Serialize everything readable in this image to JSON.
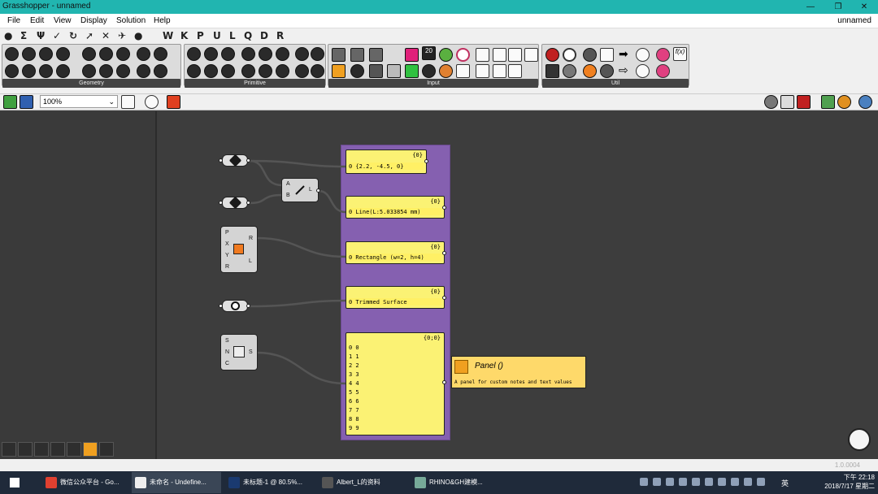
{
  "window": {
    "title": "Grasshopper - unnamed",
    "doc_name": "unnamed"
  },
  "menu": [
    "File",
    "Edit",
    "View",
    "Display",
    "Solution",
    "Help"
  ],
  "tabs": [
    "●",
    "Σ",
    "Ψ",
    "✓",
    "↻",
    "➚",
    "✕",
    "✈",
    "●",
    "W",
    "K",
    "P",
    "U",
    "L",
    "Q",
    "D",
    "R"
  ],
  "ribbon_groups": [
    "Geometry",
    "Primitive",
    "Input",
    "Util"
  ],
  "toolbar": {
    "zoom": "100%"
  },
  "components": {
    "line": {
      "in_a": "A",
      "in_b": "B",
      "out": "L"
    },
    "rect": {
      "in": [
        "P",
        "X",
        "Y",
        "R"
      ],
      "out": [
        "R",
        "L"
      ]
    },
    "series": {
      "in": [
        "S",
        "N",
        "C"
      ],
      "out": "S"
    }
  },
  "panels": [
    {
      "header": "{0}",
      "lines": [
        "0 {2.2, -4.5, 0}"
      ]
    },
    {
      "header": "{0}",
      "lines": [
        "0 Line(L:5.033854 mm)"
      ]
    },
    {
      "header": "{0}",
      "lines": [
        "0 Rectangle (w=2, h=4)"
      ]
    },
    {
      "header": "{0}",
      "lines": [
        "0 Trimmed Surface"
      ]
    },
    {
      "header": "{0;0}",
      "lines": [
        "0 0",
        "1 1",
        "2 2",
        "3 3",
        "4 4",
        "5 5",
        "6 6",
        "7 7",
        "8 8",
        "9 9"
      ]
    }
  ],
  "tooltip": {
    "title": "Panel ()",
    "desc": "A panel for custom notes and text values"
  },
  "version": "1.0.0004",
  "taskbar": {
    "items": [
      "微信公众平台 - Go...",
      "未命名 - Undefine...",
      "未标题-1 @ 80.5%...",
      "Albert_L的资料",
      "RHINO&GH建模..."
    ],
    "lang": "英",
    "time": "下午 22:18",
    "date": "2018/7/17 星期二"
  },
  "colors": {
    "title_bar": "#21b5b0",
    "canvas": "#3d3d3d",
    "group": "#8560b0",
    "panel": "#fbf274",
    "taskbar": "#1f2a3a"
  }
}
